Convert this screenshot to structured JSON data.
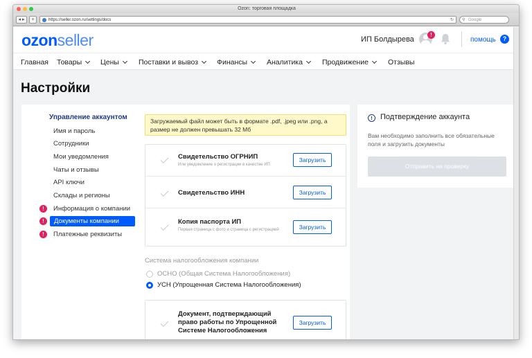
{
  "window": {
    "title": "Ozon: торговая площадка",
    "url": "https://seller.ozon.ru/settings/docs",
    "search_placeholder": "Google"
  },
  "header": {
    "logo_ozon": "ozon",
    "logo_seller": "seller",
    "user_name": "ИП Болдырева",
    "avatar_badge": "!",
    "help_label": "помощь",
    "help_icon": "?"
  },
  "nav": {
    "items": [
      {
        "label": "Главная",
        "dropdown": false
      },
      {
        "label": "Товары",
        "dropdown": true
      },
      {
        "label": "Цены",
        "dropdown": true
      },
      {
        "label": "Поставки и вывоз",
        "dropdown": true
      },
      {
        "label": "Финансы",
        "dropdown": true
      },
      {
        "label": "Аналитика",
        "dropdown": true
      },
      {
        "label": "Продвижение",
        "dropdown": true
      },
      {
        "label": "Отзывы",
        "dropdown": false
      }
    ]
  },
  "page": {
    "title": "Настройки"
  },
  "sidebar": {
    "heading": "Управление аккаунтом",
    "items": [
      {
        "label": "Имя и пароль",
        "warning": false,
        "active": false
      },
      {
        "label": "Сотрудники",
        "warning": false,
        "active": false
      },
      {
        "label": "Мои уведомления",
        "warning": false,
        "active": false
      },
      {
        "label": "Чаты и отзывы",
        "warning": false,
        "active": false
      },
      {
        "label": "API ключи",
        "warning": false,
        "active": false
      },
      {
        "label": "Склады и регионы",
        "warning": false,
        "active": false
      },
      {
        "label": "Информация о компании",
        "warning": true,
        "active": false
      },
      {
        "label": "Документы компании",
        "warning": true,
        "active": true
      },
      {
        "label": "Платежные реквизиты",
        "warning": true,
        "active": false
      }
    ],
    "warning_glyph": "!"
  },
  "notice": {
    "text": "Загружаемый файл может быть в формате .pdf, .jpeg или .png, а размер не должен превышать 32 Мб"
  },
  "documents": [
    {
      "title": "Свидетельство ОГРНИП",
      "subtitle": "Или уведомление о регистрации в качестве ИП",
      "button": "Загрузить"
    },
    {
      "title": "Свидетельство ИНН",
      "subtitle": "",
      "button": "Загрузить"
    },
    {
      "title": "Копия паспорта ИП",
      "subtitle": "Первая страница с фото и страница с регистрацией",
      "button": "Загрузить"
    }
  ],
  "tax": {
    "label": "Система налогообложения компании",
    "options": [
      {
        "label": "ОСНО (Общая Система Налогообложения)",
        "checked": false
      },
      {
        "label": "УСН (Упрощенная Система Налогообложения)",
        "checked": true
      }
    ]
  },
  "tax_document": {
    "title_lines": [
      "Документ, подтверждающий",
      "право работы по Упрощенной",
      "Системе Налогообложения"
    ],
    "button": "Загрузить"
  },
  "confirmation": {
    "icon": "!",
    "title": "Подтверждение аккаунта",
    "text": "Вам необходимо заполнить все обязательные поля и загрузить документы",
    "submit_button": "Отправить на проверку"
  },
  "colors": {
    "accent": "#005bff",
    "warning": "#e4205c",
    "notice_bg": "#fff8c8",
    "disabled_button": "#dde1e6"
  }
}
